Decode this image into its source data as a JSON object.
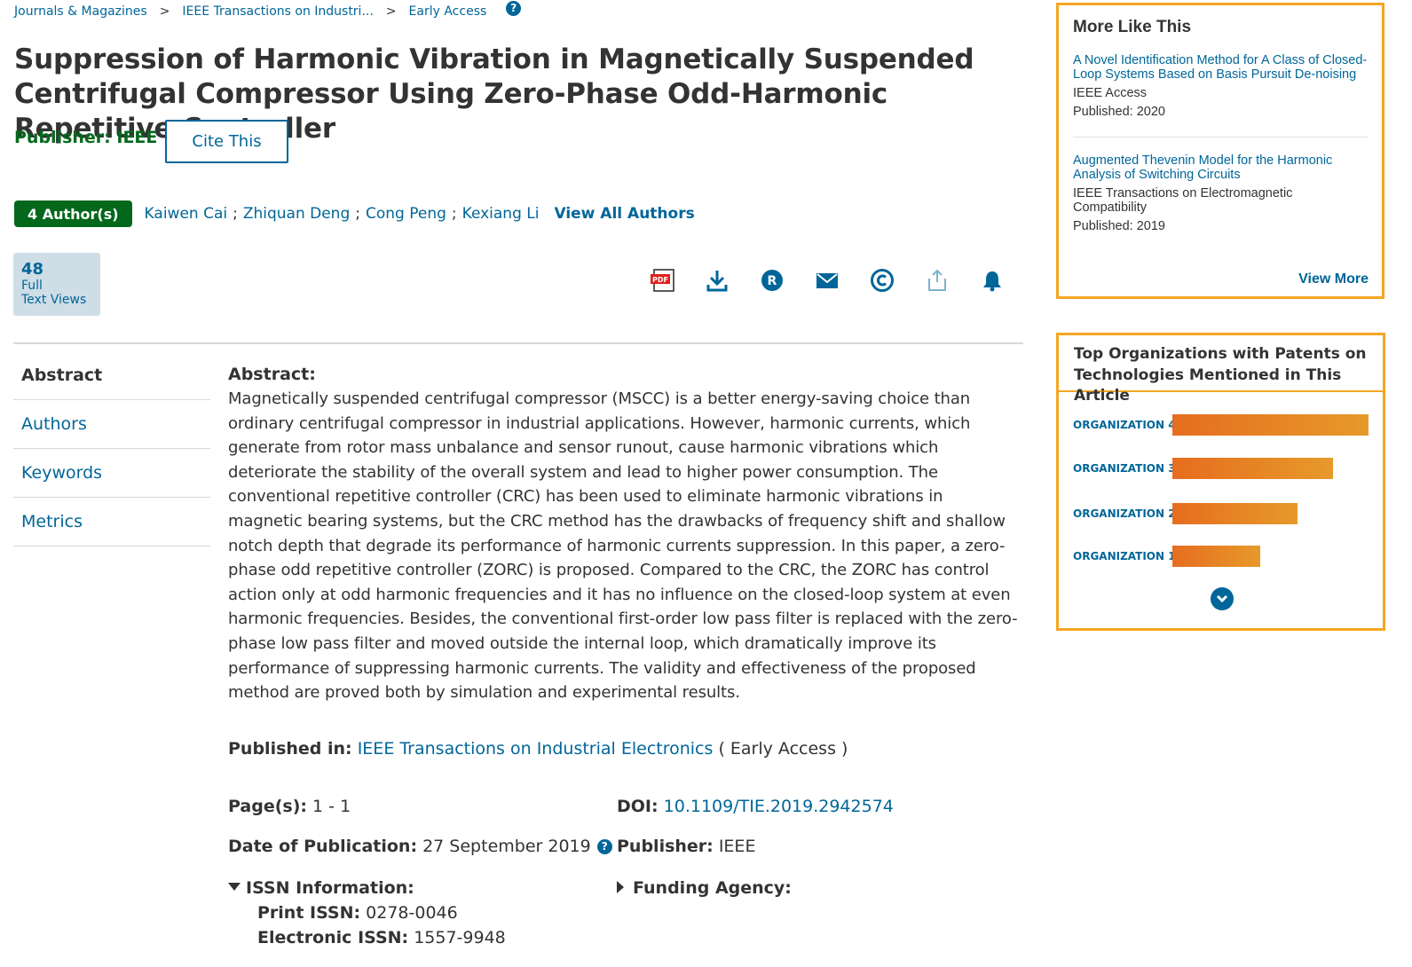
{
  "breadcrumb": {
    "items": [
      "Journals & Magazines",
      "IEEE Transactions on Industri...",
      "Early Access"
    ],
    "separator": ">"
  },
  "article": {
    "title": "Suppression of Harmonic Vibration in Magnetically Suspended Centrifugal Compressor Using Zero-Phase Odd-Harmonic Repetitive Controller",
    "publisher_line": "Publisher: IEEE",
    "cite_button": "Cite This",
    "author_count": "4 Author(s)",
    "authors": [
      "Kaiwen Cai",
      "Zhiquan Deng",
      "Cong Peng",
      "Kexiang Li"
    ],
    "author_separator": ";",
    "view_all_authors": "View All Authors",
    "views": {
      "count": "48",
      "label_line1": "Full",
      "label_line2": "Text Views"
    }
  },
  "action_icons": [
    "pdf-icon",
    "download-icon",
    "rights-icon",
    "email-icon",
    "copyright-icon",
    "share-icon",
    "alert-bell-icon"
  ],
  "side_nav": [
    "Abstract",
    "Authors",
    "Keywords",
    "Metrics"
  ],
  "abstract": {
    "heading": "Abstract:",
    "text": "Magnetically suspended centrifugal compressor (MSCC) is a better energy-saving choice than ordinary centrifugal compressor in industrial applications. However, harmonic currents, which generate from rotor mass unbalance and sensor runout, cause harmonic vibrations which deteriorate the stability of the overall system and lead to higher power consumption. The conventional repetitive controller (CRC) has been used to eliminate harmonic vibrations in magnetic bearing systems, but the CRC method has the drawbacks of frequency shift and shallow notch depth that degrade its performance of harmonic currents suppression. In this paper, a zero-phase odd repetitive controller (ZORC) is proposed. Compared to the CRC, the ZORC has control action only at odd harmonic frequencies and it has no influence on the closed-loop system at even harmonic frequencies. Besides, the conventional first-order low pass filter is replaced with the zero-phase low pass filter and moved outside the internal loop, which dramatically improve its performance of suppressing harmonic currents. The validity and effectiveness of the proposed method are proved both by simulation and experimental results."
  },
  "metadata": {
    "published_in_label": "Published in:",
    "published_in_value": "IEEE Transactions on Industrial Electronics",
    "published_in_suffix": "( Early Access )",
    "pages_label": "Page(s):",
    "pages_value": "1 - 1",
    "doi_label": "DOI:",
    "doi_value": "10.1109/TIE.2019.2942574",
    "date_label": "Date of Publication:",
    "date_value": "27 September 2019",
    "publisher_label": "Publisher:",
    "publisher_value": "IEEE",
    "issn_label": "ISSN Information:",
    "print_issn_label": "Print ISSN:",
    "print_issn_value": "0278-0046",
    "electronic_issn_label": "Electronic ISSN:",
    "electronic_issn_value": "1557-9948",
    "funding_label": "Funding Agency:"
  },
  "more_like_this": {
    "title": "More Like This",
    "items": [
      {
        "title": "A Novel Identification Method for A Class of Closed-Loop Systems Based on Basis Pursuit De-noising",
        "venue": "IEEE Access",
        "published": "Published: 2020"
      },
      {
        "title": "Augmented Thevenin Model for the Harmonic Analysis of Switching Circuits",
        "venue": "IEEE Transactions on Electromagnetic Compatibility",
        "published": "Published: 2019"
      }
    ],
    "view_more": "View More"
  },
  "top_orgs": {
    "title_line1": "Top Organizations with Patents on",
    "title_line2": "Technologies Mentioned in This Article",
    "items": [
      {
        "label": "ORGANIZATION 4",
        "value": 1.0
      },
      {
        "label": "ORGANIZATION 3",
        "value": 0.82
      },
      {
        "label": "ORGANIZATION 2",
        "value": 0.64
      },
      {
        "label": "ORGANIZATION 1",
        "value": 0.45
      }
    ],
    "colors": {
      "bar_start": "#e66d1f",
      "bar_end": "#e69a2a"
    }
  },
  "colors": {
    "link": "#006699",
    "publisher_green": "#04681c",
    "panel_border": "#f5a623"
  }
}
